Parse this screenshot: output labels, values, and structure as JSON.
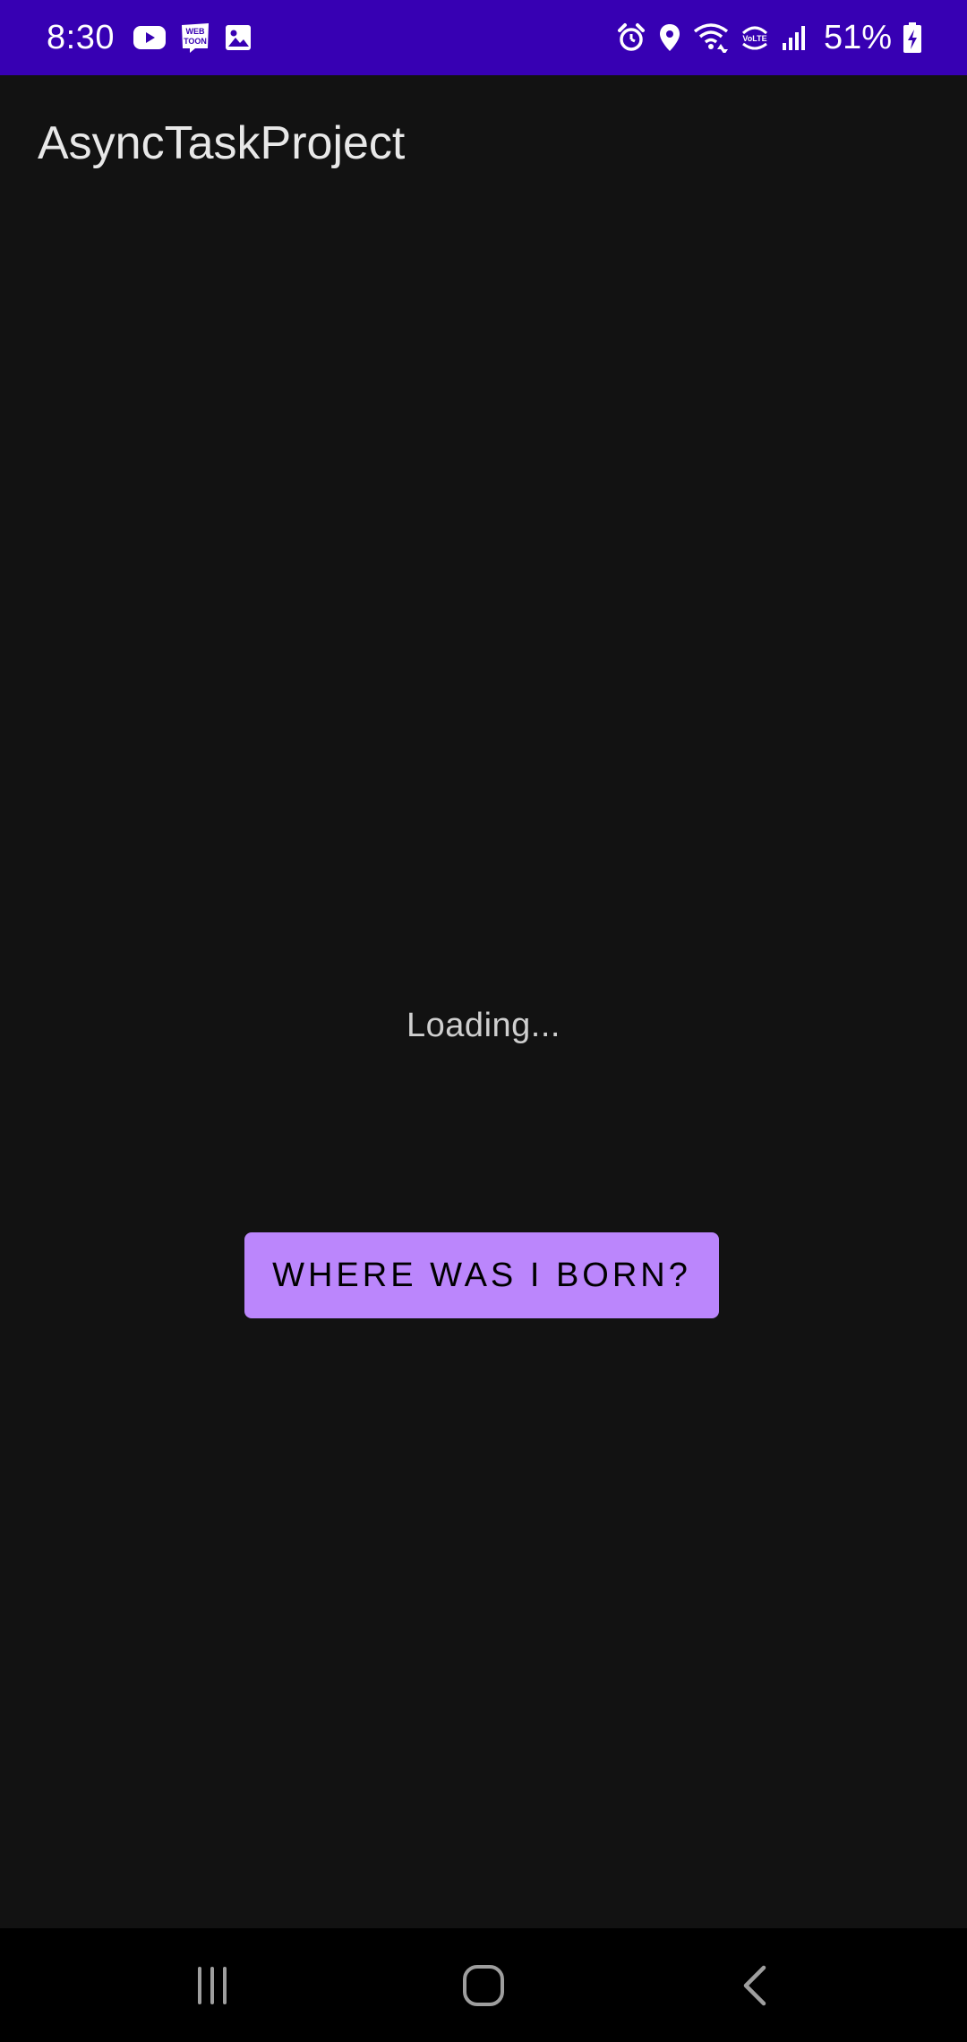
{
  "status_bar": {
    "time": "8:30",
    "battery": "51%",
    "left_icons": [
      "youtube-icon",
      "webtoon-icon",
      "gallery-icon"
    ],
    "webtoon_label_top": "WEB",
    "webtoon_label_bottom": "TOON",
    "right_icons": [
      "alarm-icon",
      "location-icon",
      "wifi-icon",
      "volte-icon",
      "signal-icon",
      "battery-charging-icon"
    ],
    "volte_label": "VoLTE"
  },
  "app_bar": {
    "title": "AsyncTaskProject"
  },
  "content": {
    "loading_text": "Loading...",
    "button_label": "WHERE WAS I BORN?"
  },
  "nav_bar": {
    "buttons": [
      "recents-icon",
      "home-icon",
      "back-icon"
    ]
  },
  "colors": {
    "status_bar": "#3700b3",
    "background": "#121212",
    "button": "#bb86fc",
    "nav_bar": "#000000"
  }
}
